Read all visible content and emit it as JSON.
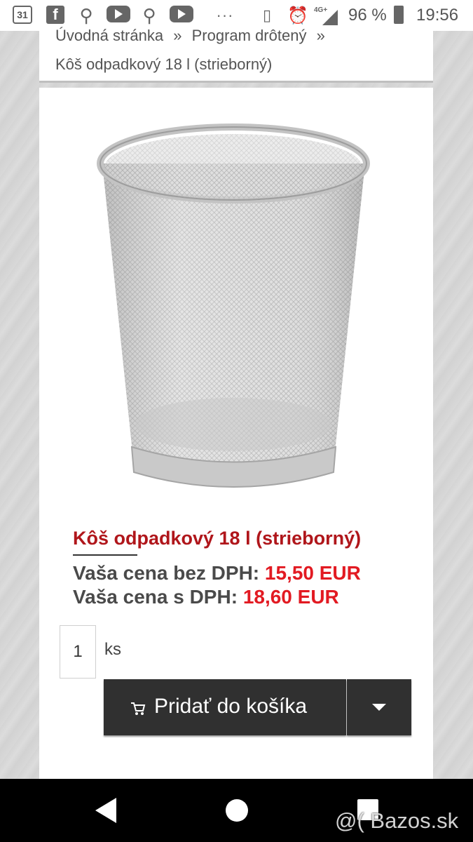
{
  "status_bar": {
    "calendar_day": "31",
    "icons": [
      "calendar-icon",
      "facebook-icon",
      "location-icon",
      "youtube-icon",
      "location-icon",
      "youtube-icon",
      "more-icon",
      "vibrate-icon",
      "alarm-icon",
      "signal-icon",
      "battery-icon"
    ],
    "network": "4G+",
    "battery_percent": "96 %",
    "time": "19:56"
  },
  "breadcrumb": {
    "home": "Úvodná stránka",
    "separator": "»",
    "category": "Program drôtený",
    "separator2": "»",
    "current": "Kôš odpadkový 18 l (strieborný)"
  },
  "product": {
    "title": "Kôš odpadkový 18 l (strieborný)",
    "price_without_vat_label": "Vaša cena bez DPH:",
    "price_without_vat": "15,50 EUR",
    "price_with_vat_label": "Vaša cena s DPH:",
    "price_with_vat": "18,60 EUR",
    "quantity": "1",
    "unit": "ks",
    "add_to_cart_label": "Pridať do košíka",
    "colors": {
      "title": "#b0161b",
      "price": "#e21a22",
      "button": "#303030"
    }
  },
  "navigation": {
    "buttons": [
      "back",
      "home",
      "recent-apps"
    ]
  },
  "watermark": "@( Bazos.sk"
}
